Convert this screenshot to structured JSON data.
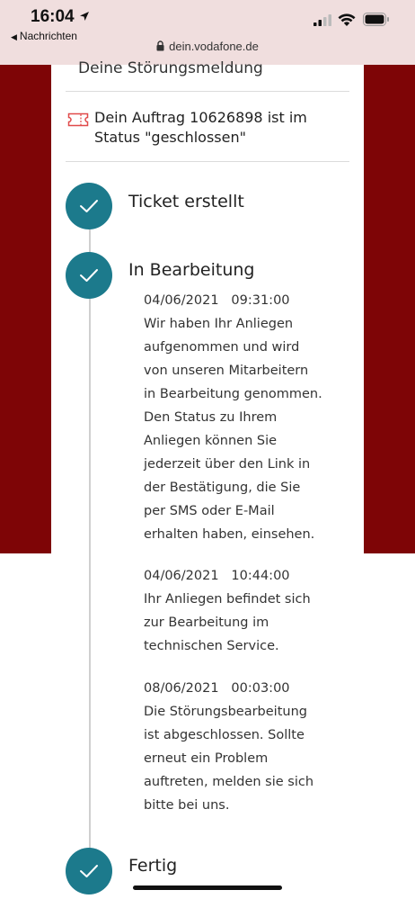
{
  "status_bar": {
    "time": "16:04",
    "back_app": "Nachrichten",
    "url": "dein.vodafone.de"
  },
  "card": {
    "section_heading": "Deine Störungsmeldung",
    "order_status": "Dein Auftrag 10626898 ist im Status \"geschlossen\""
  },
  "steps": [
    {
      "title": "Ticket erstellt",
      "entries": []
    },
    {
      "title": "In Bearbeitung",
      "entries": [
        {
          "datetime": "04/06/2021   09:31:00",
          "text": "Wir haben Ihr Anliegen aufgenommen und wird von unseren Mitarbeitern in Bearbeitung genommen. Den Status zu Ihrem Anliegen können Sie jederzeit über den Link in der Bestätigung, die Sie per SMS oder E-Mail erhalten haben, einsehen."
        },
        {
          "datetime": "04/06/2021   10:44:00",
          "text": "Ihr Anliegen befindet sich zur Bearbeitung im technischen Service."
        },
        {
          "datetime": "08/06/2021   00:03:00",
          "text": "Die Störungsbearbeitung ist abgeschlossen. Sollte erneut ein Problem auftreten, melden sie sich bitte bei uns."
        }
      ]
    },
    {
      "title": "Fertig",
      "entries": []
    }
  ],
  "colors": {
    "brand_red": "#7e0506",
    "step_teal": "#1c7a8c",
    "ticket_icon": "#e04a4a"
  },
  "icons": [
    "location-arrow-icon",
    "signal-icon",
    "wifi-icon",
    "battery-icon",
    "lock-icon",
    "ticket-icon",
    "checkmark-icon"
  ]
}
